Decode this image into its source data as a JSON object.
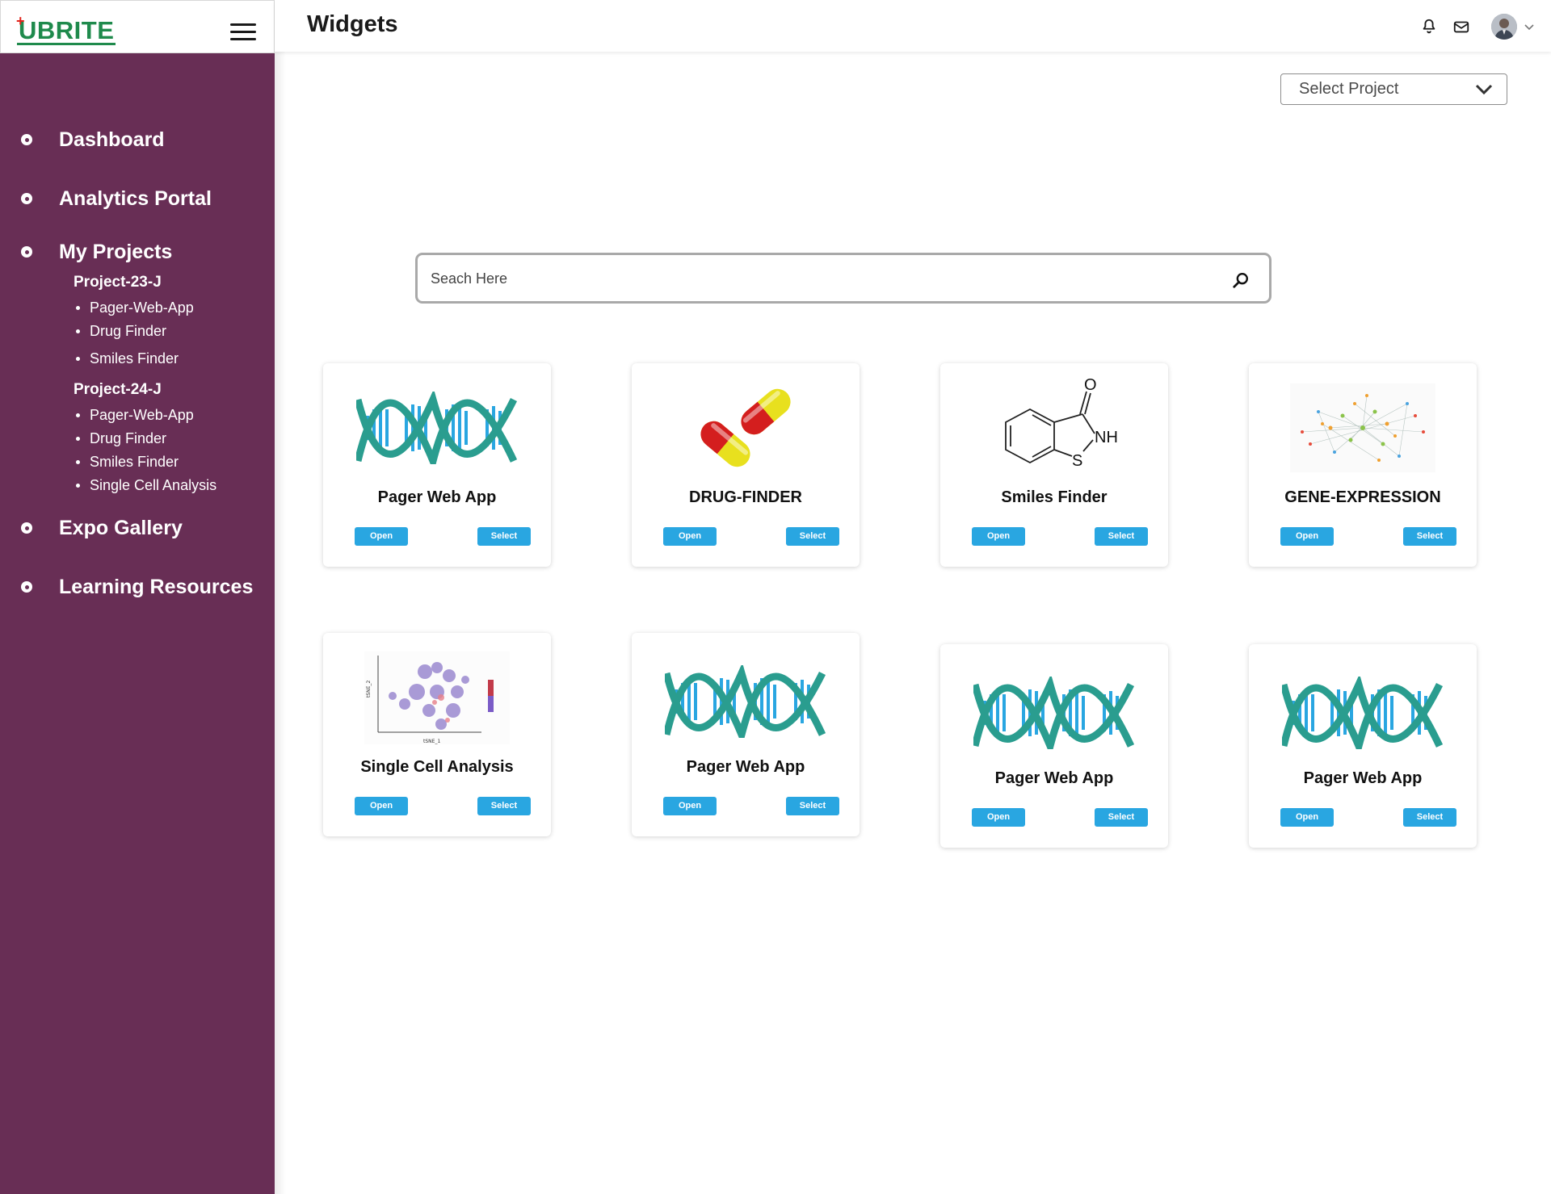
{
  "brand": {
    "logo_text": "UBRITE",
    "logo_plus": "+"
  },
  "header": {
    "title": "Widgets"
  },
  "icons": {
    "bell": "bell-icon",
    "mail": "mail-icon",
    "avatar": "avatar",
    "chevron": "chevron-down-icon",
    "search": "search-icon"
  },
  "sidebar": {
    "items": [
      {
        "label": "Dashboard"
      },
      {
        "label": "Analytics Portal"
      },
      {
        "label": "My Projects"
      },
      {
        "label": "Expo Gallery"
      },
      {
        "label": "Learning Resources"
      }
    ],
    "projects": [
      {
        "title": "Project-23-J",
        "items": [
          "Pager-Web-App",
          "Drug Finder",
          "Smiles Finder"
        ]
      },
      {
        "title": "Project-24-J",
        "items": [
          "Pager-Web-App",
          "Drug Finder",
          "Smiles Finder",
          "Single Cell Analysis"
        ]
      }
    ]
  },
  "select_project": {
    "label": "Select Project"
  },
  "search": {
    "placeholder": "Seach Here"
  },
  "cards": [
    {
      "title": "Pager Web App",
      "image": "dna-image",
      "open": "Open",
      "select": "Select"
    },
    {
      "title": "DRUG-FINDER",
      "image": "capsules-image",
      "open": "Open",
      "select": "Select"
    },
    {
      "title": "Smiles Finder",
      "image": "molecule-image",
      "open": "Open",
      "select": "Select"
    },
    {
      "title": "GENE-EXPRESSION",
      "image": "network-image",
      "open": "Open",
      "select": "Select"
    },
    {
      "title": "Single Cell Analysis",
      "image": "tsne-plot-image",
      "open": "Open",
      "select": "Select"
    },
    {
      "title": "Pager Web App",
      "image": "dna-image",
      "open": "Open",
      "select": "Select"
    },
    {
      "title": "Pager Web App",
      "image": "dna-image",
      "open": "Open",
      "select": "Select"
    },
    {
      "title": "Pager Web App",
      "image": "dna-image",
      "open": "Open",
      "select": "Select"
    }
  ],
  "molecule_labels": {
    "o": "O",
    "nh": "NH",
    "s": "S"
  },
  "tsne_labels": {
    "xlabel": "tSNE_1",
    "ylabel": "tSNE_2"
  },
  "colors": {
    "sidebar": "#682e55",
    "button": "#29a6e1",
    "dna_teal": "#2a9d8f",
    "dna_blue": "#29a6e1",
    "brand_green": "#1f8a4c"
  }
}
